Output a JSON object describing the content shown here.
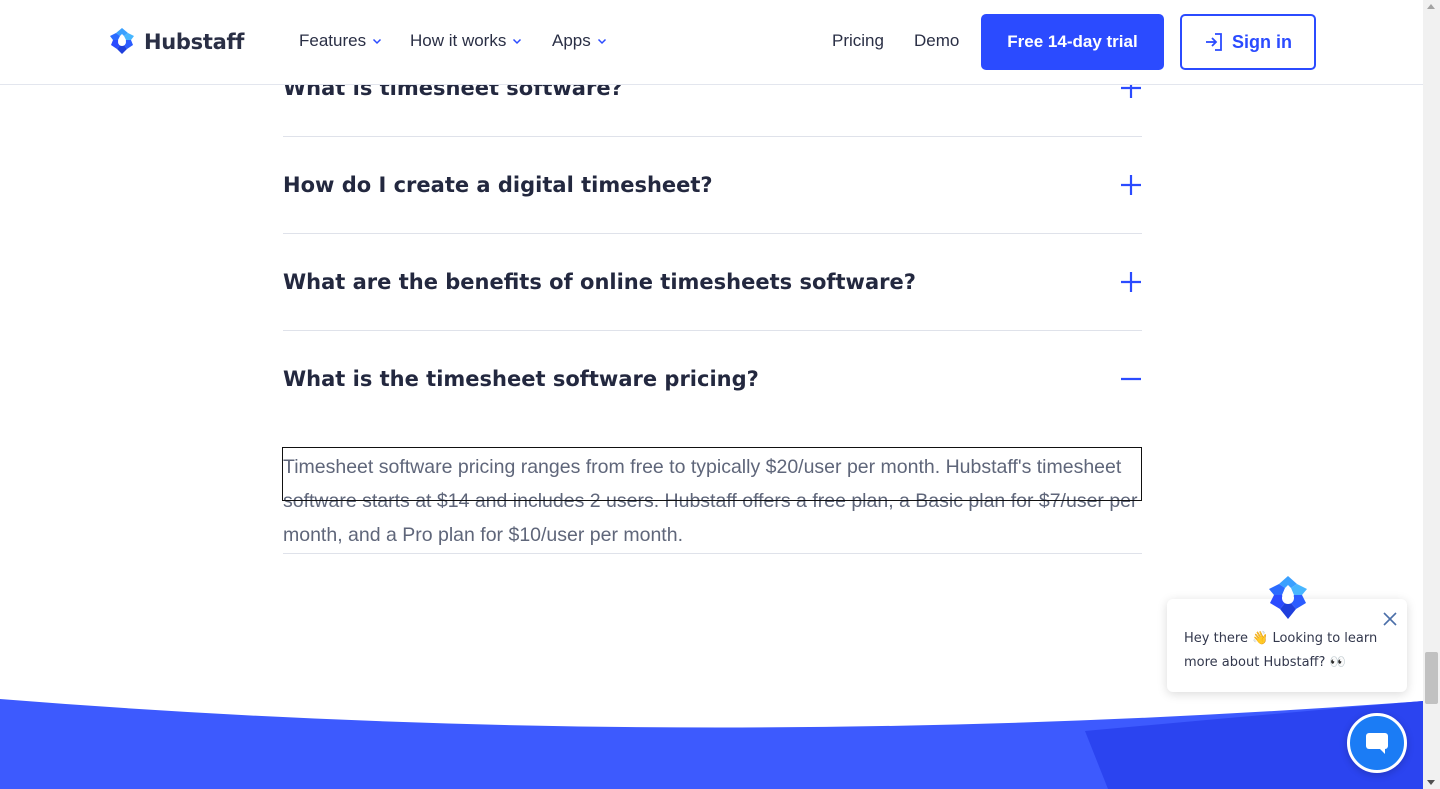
{
  "header": {
    "logo_text": "Hubstaff",
    "nav": [
      {
        "label": "Features"
      },
      {
        "label": "How it works"
      },
      {
        "label": "Apps"
      }
    ],
    "pricing_label": "Pricing",
    "demo_label": "Demo",
    "trial_label": "Free 14-day trial",
    "signin_label": "Sign in"
  },
  "faq": {
    "items": [
      {
        "question": "What is timesheet software?",
        "expanded": false
      },
      {
        "question": "How do I create a digital timesheet?",
        "expanded": false
      },
      {
        "question": "What are the benefits of online timesheets software?",
        "expanded": false
      },
      {
        "question": "What is the timesheet software pricing?",
        "expanded": true
      }
    ],
    "answer": "Timesheet software pricing ranges from free to typically $20/user per month. Hubstaff's timesheet software starts at $14 and includes 2 users. Hubstaff offers a free plan, a Basic plan for $7/user per month, and a Pro plan for $10/user per month."
  },
  "chat": {
    "message": "Hey there 👋 Looking to learn more about Hubstaff? 👀"
  },
  "colors": {
    "brand_blue": "#2b4bff",
    "text_dark": "#23283f",
    "text_muted": "#5f667a",
    "chat_blue": "#1b7cf5"
  },
  "icons": {
    "logo": "hubstaff-logo-icon",
    "expand": "plus-icon",
    "collapse": "minus-icon",
    "signin": "sign-in-arrow-icon",
    "chat": "chat-bubble-icon",
    "close": "close-icon"
  }
}
